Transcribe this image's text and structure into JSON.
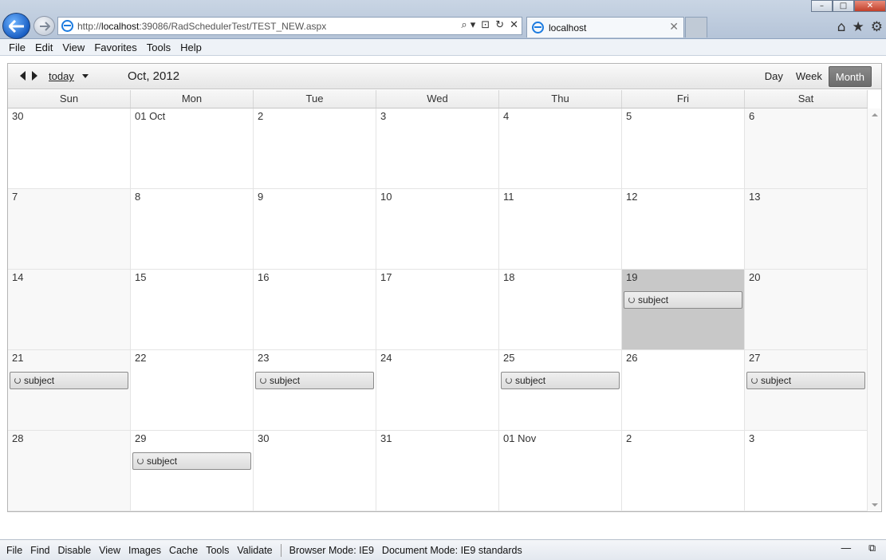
{
  "browser": {
    "url_prefix": "http://",
    "url_host": "localhost",
    "url_rest": ":39086/RadSchedulerTest/TEST_NEW.aspx",
    "tab_title": "localhost",
    "tab_close": "✕",
    "addr_search": "⌕ ▾",
    "addr_compat": "⊡",
    "addr_refresh": "↻",
    "addr_stop": "✕",
    "home_icon": "⌂",
    "star_icon": "★",
    "gear_icon": "⚙"
  },
  "menu": {
    "items": [
      "File",
      "Edit",
      "View",
      "Favorites",
      "Tools",
      "Help"
    ]
  },
  "scheduler": {
    "today_label": "today",
    "period_label": "Oct, 2012",
    "views": [
      "Day",
      "Week",
      "Month"
    ],
    "active_view": "Month",
    "day_headers": [
      "Sun",
      "Mon",
      "Tue",
      "Wed",
      "Thu",
      "Fri",
      "Sat"
    ],
    "weeks": [
      [
        {
          "d": "30",
          "t": "other"
        },
        {
          "d": "01 Oct"
        },
        {
          "d": "2"
        },
        {
          "d": "3"
        },
        {
          "d": "4"
        },
        {
          "d": "5"
        },
        {
          "d": "6",
          "t": "weekend"
        }
      ],
      [
        {
          "d": "7",
          "t": "weekend"
        },
        {
          "d": "8"
        },
        {
          "d": "9"
        },
        {
          "d": "10"
        },
        {
          "d": "11"
        },
        {
          "d": "12"
        },
        {
          "d": "13",
          "t": "weekend"
        }
      ],
      [
        {
          "d": "14",
          "t": "weekend"
        },
        {
          "d": "15"
        },
        {
          "d": "16"
        },
        {
          "d": "17"
        },
        {
          "d": "18"
        },
        {
          "d": "19",
          "t": "selected",
          "appt": "subject"
        },
        {
          "d": "20",
          "t": "weekend"
        }
      ],
      [
        {
          "d": "21",
          "t": "weekend",
          "appt": "subject"
        },
        {
          "d": "22"
        },
        {
          "d": "23",
          "appt": "subject"
        },
        {
          "d": "24"
        },
        {
          "d": "25",
          "appt": "subject"
        },
        {
          "d": "26"
        },
        {
          "d": "27",
          "t": "weekend",
          "appt": "subject"
        }
      ],
      [
        {
          "d": "28",
          "t": "weekend"
        },
        {
          "d": "29",
          "appt": "subject"
        },
        {
          "d": "30"
        },
        {
          "d": "31"
        },
        {
          "d": "01 Nov",
          "t": "other"
        },
        {
          "d": "2",
          "t": "other"
        },
        {
          "d": "3",
          "t": "other"
        }
      ]
    ]
  },
  "devtools": {
    "items": [
      "File",
      "Find",
      "Disable",
      "View",
      "Images",
      "Cache",
      "Tools",
      "Validate"
    ],
    "browser_mode": "Browser Mode:  IE9",
    "document_mode": "Document Mode:  IE9 standards",
    "minimize": "—",
    "restore": "⧉"
  }
}
